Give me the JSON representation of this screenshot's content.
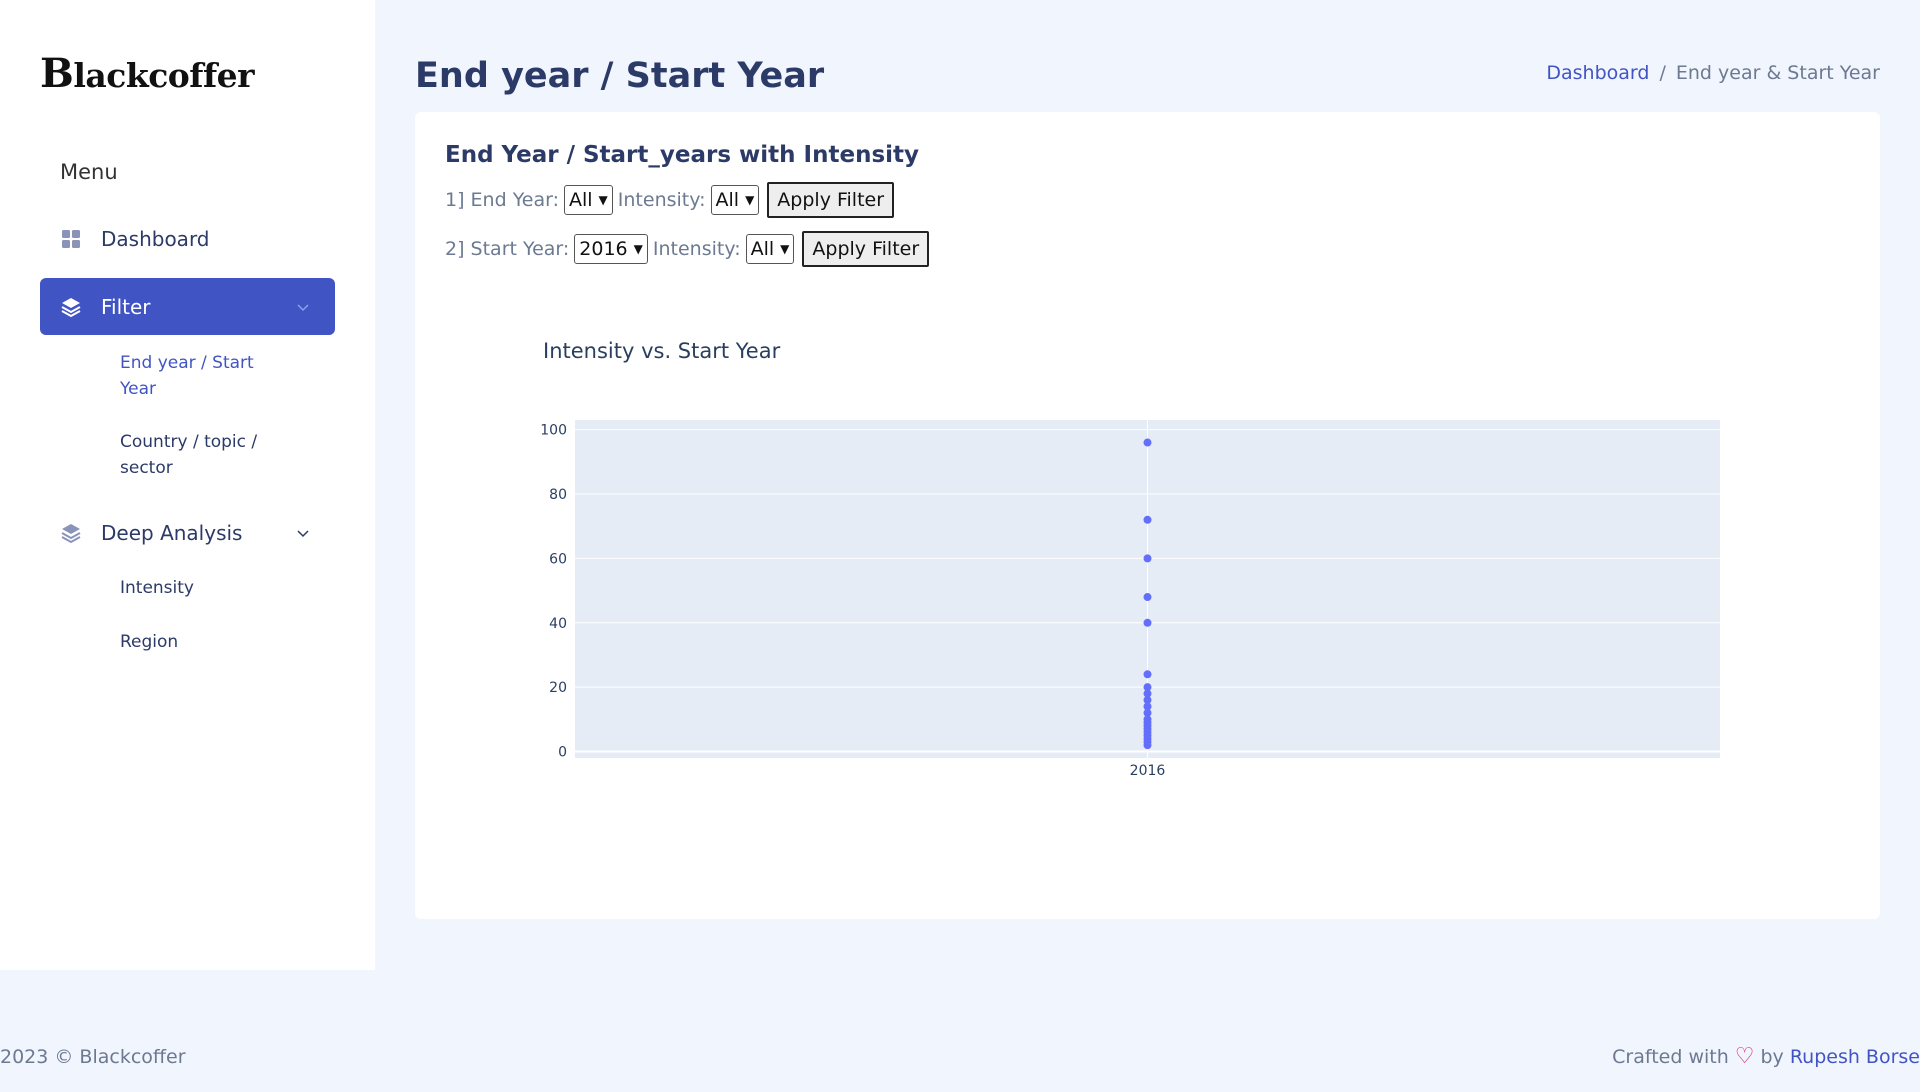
{
  "sidebar": {
    "logo_first": "B",
    "logo_rest": "lackcoffer",
    "menu_label": "Menu",
    "dashboard_label": "Dashboard",
    "filter_label": "Filter",
    "filter_subitems": [
      "End year / Start Year",
      "Country / topic / sector"
    ],
    "deep_label": "Deep Analysis",
    "deep_subitems": [
      "Intensity",
      "Region"
    ]
  },
  "header": {
    "title": "End year / Start Year",
    "breadcrumb": [
      "Dashboard",
      "/",
      "End year & Start Year"
    ]
  },
  "card": {
    "title": "End Year / Start_years with Intensity",
    "row1": {
      "label1": "1] End Year:",
      "select1": "All",
      "label2": "Intensity:",
      "select2": "All",
      "button": "Apply Filter"
    },
    "row2": {
      "label1": "2] Start Year:",
      "select1": "2016",
      "label2": "Intensity:",
      "select2": "All",
      "button": "Apply Filter"
    }
  },
  "chart_data": {
    "type": "scatter",
    "title": "Intensity vs. Start Year",
    "xlabel": "",
    "ylabel": "",
    "x_categories": [
      "2016"
    ],
    "ylim": [
      -2,
      103
    ],
    "yticks": [
      0,
      20,
      40,
      60,
      80,
      100
    ],
    "grid": true,
    "series": [
      {
        "x": [
          "2016",
          "2016",
          "2016",
          "2016",
          "2016",
          "2016",
          "2016",
          "2016",
          "2016",
          "2016",
          "2016",
          "2016",
          "2016",
          "2016",
          "2016",
          "2016",
          "2016",
          "2016",
          "2016",
          "2016"
        ],
        "y": [
          96,
          72,
          60,
          48,
          40,
          24,
          20,
          18,
          16,
          14,
          12,
          10,
          9,
          8,
          7,
          6,
          5,
          4,
          3,
          2
        ]
      }
    ],
    "colors": {
      "marker": "#636efa",
      "plot_bg": "#e5ecf6"
    }
  },
  "footer": {
    "left": "2023 © Blackcoffer",
    "right_prefix": "Crafted with",
    "right_by": "by",
    "author": "Rupesh Borse"
  }
}
